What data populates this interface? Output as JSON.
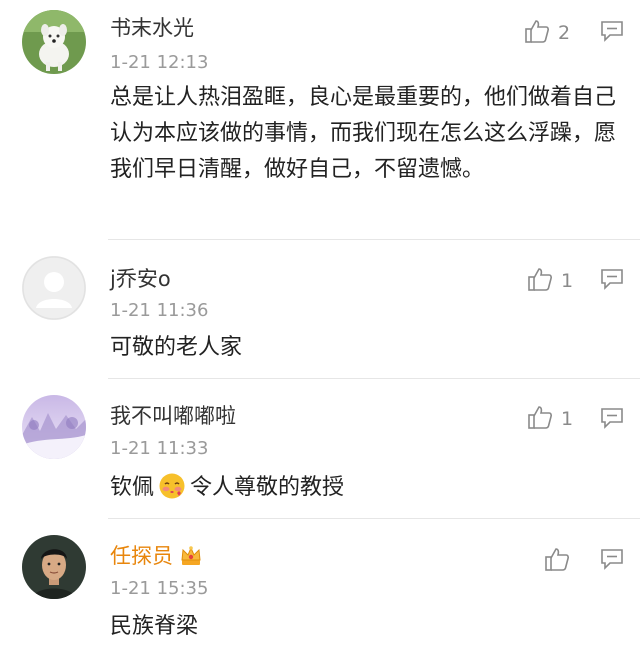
{
  "comments": [
    {
      "username": "书末水光",
      "time": "1-21 12:13",
      "likes": "2",
      "text": "总是让人热泪盈眶，良心是最重要的，他们做着自己认为本应该做的事情，而我们现在怎么这么浮躁，愿我们早日清醒，做好自己，不留遗憾。",
      "avatar": "white-dog-avatar"
    },
    {
      "username": "j乔安o",
      "time": "1-21 11:36",
      "likes": "1",
      "text": "可敬的老人家",
      "avatar": "default-user-avatar"
    },
    {
      "username": "我不叫嘟嘟啦",
      "time": "1-21 11:33",
      "likes": "1",
      "text_before": "钦佩",
      "emoji": "blushing-face-emoji",
      "text_after": "令人尊敬的教授",
      "avatar": "snowy-landscape-avatar"
    },
    {
      "username": "任探员",
      "time": "1-21 15:35",
      "likes": "",
      "text": "民族脊梁",
      "badge": "crown-icon",
      "avatar": "man-portrait-avatar"
    }
  ],
  "colors": {
    "vip_name": "#e8860c",
    "text": "#222222",
    "meta": "#9a9a9a",
    "separator": "#e6e6e6"
  }
}
